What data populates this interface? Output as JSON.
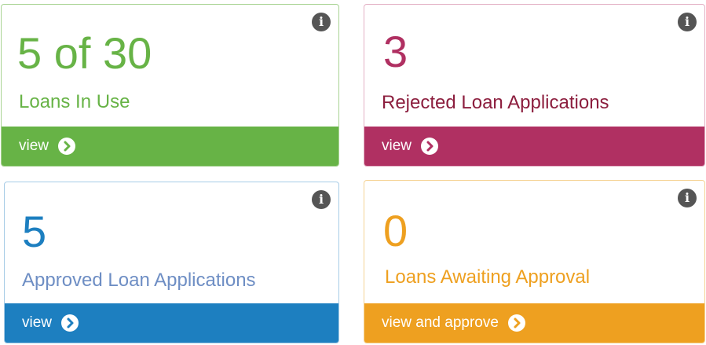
{
  "cards": [
    {
      "id": "loans-in-use",
      "value": "5 of 30",
      "label": "Loans In Use",
      "action": "view",
      "color": "#67B346",
      "border": "#A8D393",
      "label_color": "#67B346"
    },
    {
      "id": "rejected",
      "value": "3",
      "label": "Rejected Loan Applications",
      "action": "view",
      "color": "#B03062",
      "border": "#E3B0C4",
      "label_color": "#8C1E3E"
    },
    {
      "id": "approved",
      "value": "5",
      "label": "Approved Loan Applications",
      "action": "view",
      "color": "#1D7FC0",
      "border": "#A7CCE6",
      "label_color": "#6E8EC4"
    },
    {
      "id": "awaiting",
      "value": "0",
      "label": "Loans Awaiting Approval",
      "action": "view and approve",
      "color": "#EEA020",
      "border": "#F5D394",
      "label_color": "#EEA020"
    }
  ],
  "icons": {
    "info": "info-icon",
    "chevron": "chevron-right-circle-icon"
  }
}
